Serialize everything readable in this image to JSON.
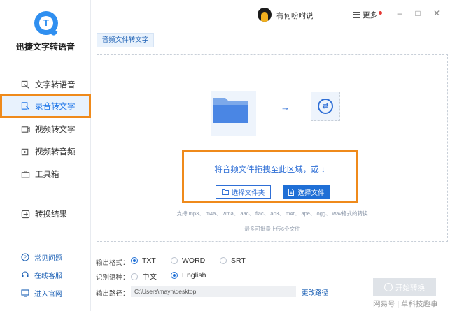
{
  "app": {
    "name": "迅捷文字转语音",
    "logo_letter": "T"
  },
  "sidebar": {
    "items": [
      {
        "label": "文字转语音",
        "icon": "text-to-speech-icon"
      },
      {
        "label": "录音转文字",
        "icon": "record-to-text-icon",
        "active": true
      },
      {
        "label": "视频转文字",
        "icon": "video-to-text-icon"
      },
      {
        "label": "视频转音频",
        "icon": "video-to-audio-icon"
      },
      {
        "label": "工具箱",
        "icon": "toolbox-icon"
      },
      {
        "label": "转换结果",
        "icon": "results-icon"
      }
    ],
    "help": [
      {
        "label": "常见问题",
        "icon": "faq-icon"
      },
      {
        "label": "在线客服",
        "icon": "headset-icon"
      },
      {
        "label": "进入官网",
        "icon": "website-icon"
      }
    ]
  },
  "header": {
    "username": "有何吩咐说",
    "more_label": "更多",
    "minimize": "–",
    "maximize": "□",
    "close": "✕"
  },
  "tab": {
    "label": "音频文件转文字"
  },
  "dropzone": {
    "arrow": "→",
    "convert_glyph": "⇄",
    "prompt": "将音频文件拖拽至此区域，或 ↓",
    "select_folder_label": "选择文件夹",
    "select_file_label": "选择文件",
    "supported_formats": "支持.mp3、.m4a、.wma、.aac、.flac、.ac3、.m4r、.ape、.ogg、.wav格式的转换",
    "limit": "最多可批量上传6个文件"
  },
  "options": {
    "format_label": "输出格式：",
    "formats": [
      "TXT",
      "WORD",
      "SRT"
    ],
    "language_label": "识别语种：",
    "languages": [
      "中文",
      "English"
    ],
    "path_label": "输出路径：",
    "path_value": "C:\\Users\\mayn\\desktop",
    "change_path": "更改路径",
    "start_label": "开始转换"
  },
  "watermark": "网易号 | 草科技趣事",
  "colors": {
    "accent": "#1f6fd6",
    "highlight": "#ef8a1b"
  }
}
